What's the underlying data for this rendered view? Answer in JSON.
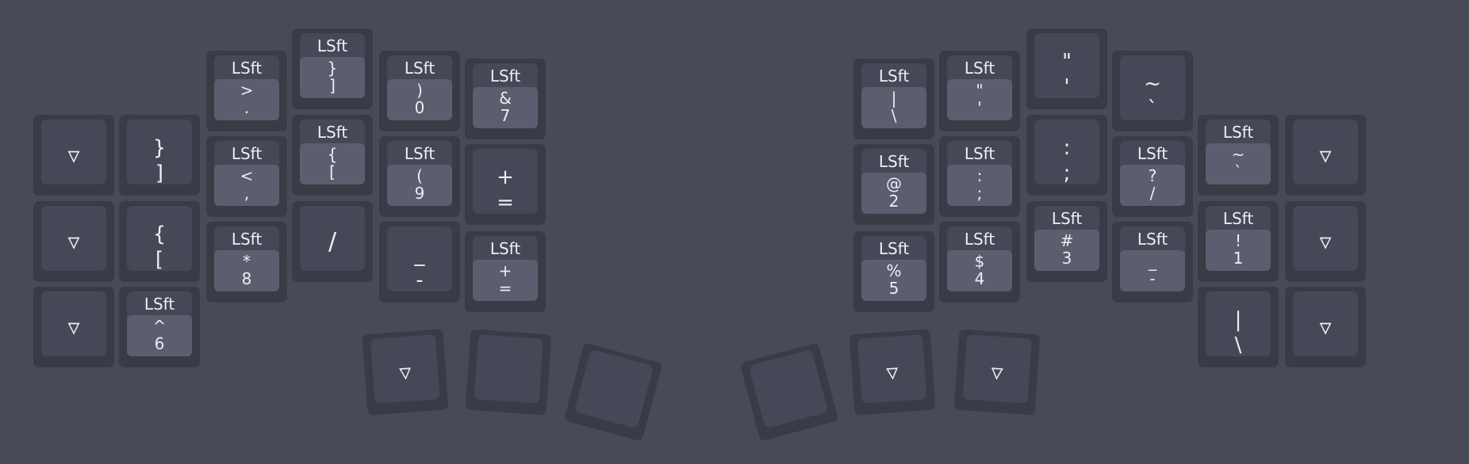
{
  "hold_label": "LSft",
  "keys": [
    {
      "type": "single",
      "label": "▿"
    },
    {
      "type": "double",
      "top": "}",
      "bottom": "]"
    },
    {
      "type": "hold",
      "top": ">",
      "bottom": "."
    },
    {
      "type": "hold",
      "top": "}",
      "bottom": "]"
    },
    {
      "type": "hold",
      "top": ")",
      "bottom": "0"
    },
    {
      "type": "hold",
      "top": "&",
      "bottom": "7"
    },
    {
      "type": "single",
      "label": "▿"
    },
    {
      "type": "double",
      "top": "{",
      "bottom": "["
    },
    {
      "type": "hold",
      "top": "<",
      "bottom": ","
    },
    {
      "type": "hold",
      "top": "{",
      "bottom": "["
    },
    {
      "type": "hold",
      "top": "(",
      "bottom": "9"
    },
    {
      "type": "double",
      "top": "+",
      "bottom": "="
    },
    {
      "type": "single",
      "label": "▿"
    },
    {
      "type": "hold",
      "top": "^",
      "bottom": "6"
    },
    {
      "type": "hold",
      "top": "*",
      "bottom": "8"
    },
    {
      "type": "single",
      "label": "/"
    },
    {
      "type": "double",
      "top": "_",
      "bottom": "-"
    },
    {
      "type": "hold",
      "top": "+",
      "bottom": "="
    },
    {
      "type": "single",
      "label": "▿"
    },
    {
      "type": "blank"
    },
    {
      "type": "blank"
    },
    {
      "type": "hold",
      "top": "|",
      "bottom": "\\"
    },
    {
      "type": "hold",
      "top": "\"",
      "bottom": "'"
    },
    {
      "type": "double",
      "top": "\"",
      "bottom": "'"
    },
    {
      "type": "double",
      "top": "~",
      "bottom": "`"
    },
    {
      "type": "hold",
      "top": "~",
      "bottom": "`"
    },
    {
      "type": "single",
      "label": "▿"
    },
    {
      "type": "hold",
      "top": "@",
      "bottom": "2"
    },
    {
      "type": "hold",
      "top": ":",
      "bottom": ";"
    },
    {
      "type": "double",
      "top": ":",
      "bottom": ";"
    },
    {
      "type": "hold",
      "top": "?",
      "bottom": "/"
    },
    {
      "type": "hold",
      "top": "!",
      "bottom": "1"
    },
    {
      "type": "single",
      "label": "▿"
    },
    {
      "type": "hold",
      "top": "%",
      "bottom": "5"
    },
    {
      "type": "hold",
      "top": "$",
      "bottom": "4"
    },
    {
      "type": "hold",
      "top": "#",
      "bottom": "3"
    },
    {
      "type": "hold",
      "top": "_",
      "bottom": "-"
    },
    {
      "type": "double",
      "top": "|",
      "bottom": "\\"
    },
    {
      "type": "single",
      "label": "▿"
    },
    {
      "type": "blank"
    },
    {
      "type": "single",
      "label": "▿"
    },
    {
      "type": "single",
      "label": "▿"
    }
  ]
}
